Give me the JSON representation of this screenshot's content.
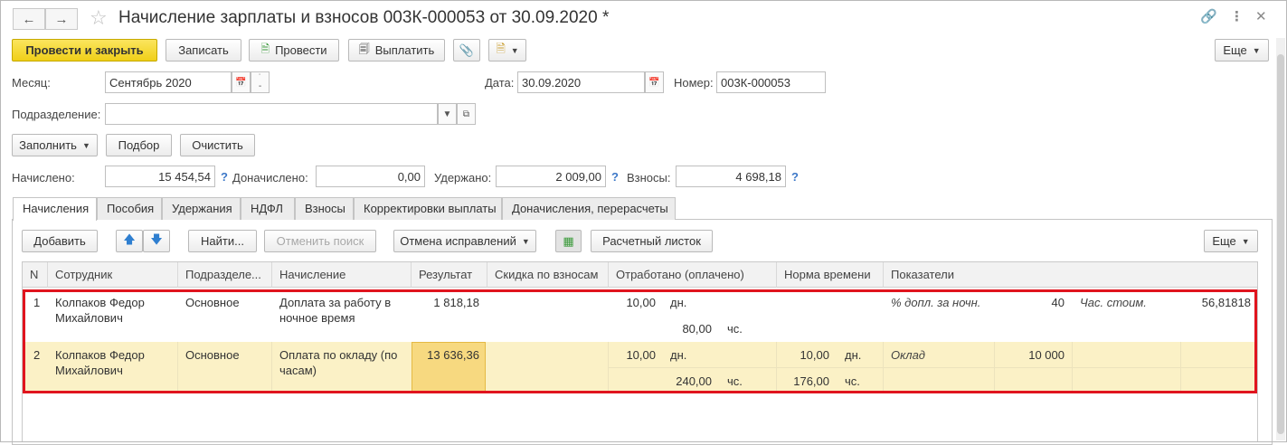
{
  "window": {
    "title": "Начисление зарплаты и взносов 003К-000053 от 30.09.2020 *"
  },
  "toolbar": {
    "post_close": "Провести и закрыть",
    "save": "Записать",
    "post": "Провести",
    "pay": "Выплатить",
    "more": "Еще"
  },
  "form": {
    "month_label": "Месяц:",
    "month_value": "Сентябрь 2020",
    "date_label": "Дата:",
    "date_value": "30.09.2020",
    "number_label": "Номер:",
    "number_value": "003К-000053",
    "division_label": "Подразделение:",
    "division_value": ""
  },
  "actions": {
    "fill": "Заполнить",
    "select": "Подбор",
    "clear": "Очистить"
  },
  "totals": {
    "accrued_label": "Начислено:",
    "accrued_value": "15 454,54",
    "additional_label": "Доначислено:",
    "additional_value": "0,00",
    "withheld_label": "Удержано:",
    "withheld_value": "2 009,00",
    "contributions_label": "Взносы:",
    "contributions_value": "4 698,18",
    "help": "?"
  },
  "tabs": [
    {
      "label": "Начисления",
      "active": true
    },
    {
      "label": "Пособия"
    },
    {
      "label": "Удержания"
    },
    {
      "label": "НДФЛ"
    },
    {
      "label": "Взносы"
    },
    {
      "label": "Корректировки выплаты"
    },
    {
      "label": "Доначисления, перерасчеты"
    }
  ],
  "tab_toolbar": {
    "add": "Добавить",
    "find": "Найти...",
    "cancel_search": "Отменить поиск",
    "cancel_fix": "Отмена исправлений",
    "payslip": "Расчетный листок",
    "more": "Еще"
  },
  "table": {
    "columns": [
      "N",
      "Сотрудник",
      "Подразделе...",
      "Начисление",
      "Результат",
      "Скидка по взносам",
      "Отработано (оплачено)",
      "Норма времени",
      "Показатели"
    ],
    "rows": [
      {
        "n": "1",
        "employee_1": "Колпаков Федор",
        "employee_2": "Михайлович",
        "division": "Основное",
        "accrual_1": "Доплата за работу в",
        "accrual_2": "ночное время",
        "result": "1 818,18",
        "discount": "",
        "worked_days": "10,00",
        "worked_days_unit": "дн.",
        "worked_hours": "80,00",
        "worked_hours_unit": "чс.",
        "norm_days": "",
        "norm_days_unit": "",
        "norm_hours": "",
        "norm_hours_unit": "",
        "ind1_name": "% допл. за ночн.",
        "ind1_value": "40",
        "ind2_name": "Час. стоим.",
        "ind2_value": "56,81818"
      },
      {
        "n": "2",
        "employee_1": "Колпаков Федор",
        "employee_2": "Михайлович",
        "division": "Основное",
        "accrual_1": "Оплата по окладу (по",
        "accrual_2": "часам)",
        "result": "13 636,36",
        "discount": "",
        "worked_days": "10,00",
        "worked_days_unit": "дн.",
        "worked_hours": "240,00",
        "worked_hours_unit": "чс.",
        "norm_days": "10,00",
        "norm_days_unit": "дн.",
        "norm_hours": "176,00",
        "norm_hours_unit": "чс.",
        "ind1_name": "Оклад",
        "ind1_value": "10 000",
        "ind2_name": "",
        "ind2_value": ""
      }
    ]
  },
  "colors": {
    "primary_button": "#f0cf18",
    "highlight_row": "#fbf1c6",
    "selected_cell": "#f7d980",
    "red_outline": "#e0141e",
    "help_blue": "#3d78c8"
  }
}
